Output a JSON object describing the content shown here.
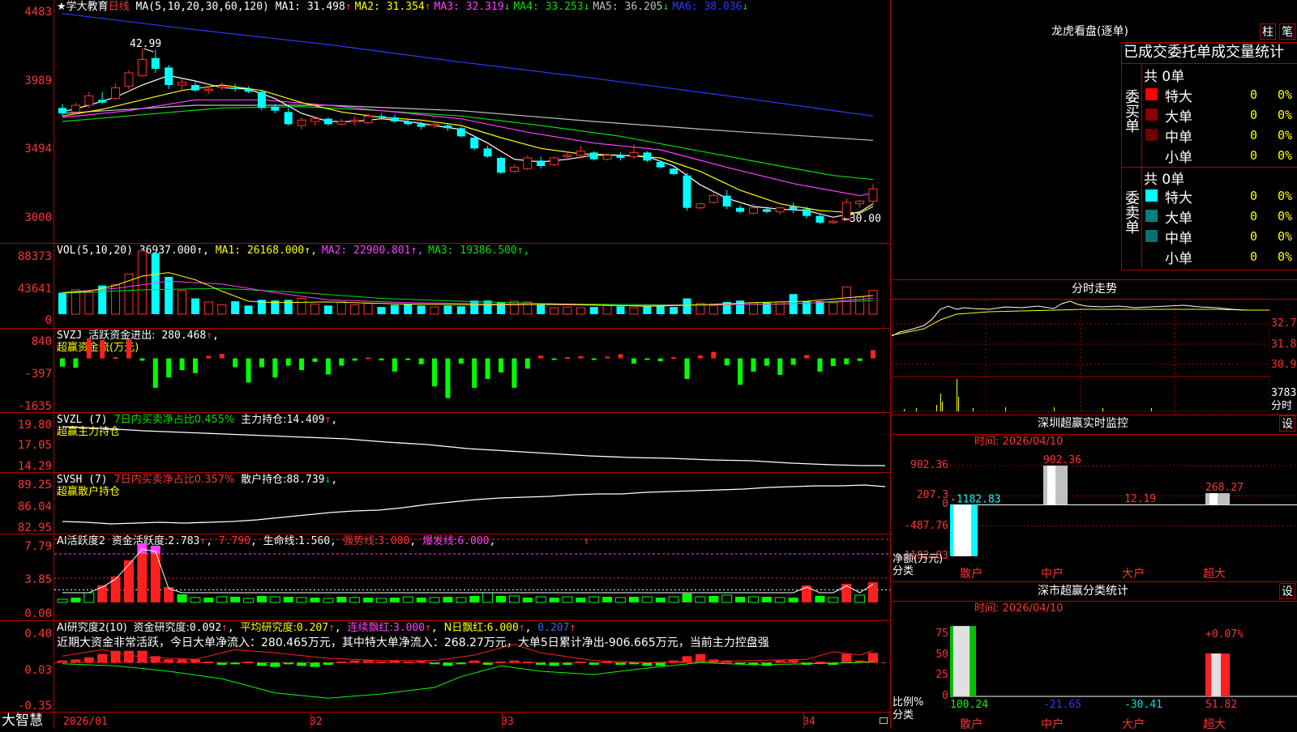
{
  "kline": {
    "title_star": "★学大教育",
    "period": "日线",
    "ma_label": "MA(5,10,20,30,60,120)",
    "ma": [
      {
        "name": "MA1",
        "value": "31.498",
        "arrow": "↑",
        "color": "#ffffff"
      },
      {
        "name": "MA2",
        "value": "31.354",
        "arrow": "↑",
        "color": "#ffff00"
      },
      {
        "name": "MA3",
        "value": "32.319",
        "arrow": "↓",
        "color": "#ff40ff"
      },
      {
        "name": "MA4",
        "value": "33.253",
        "arrow": "↓",
        "color": "#00e000"
      },
      {
        "name": "MA5",
        "value": "36.205",
        "arrow": "↓",
        "color": "#c0c0c0"
      },
      {
        "name": "MA6",
        "value": "38.036",
        "arrow": "↓",
        "color": "#2a3cff"
      }
    ],
    "y_labels": [
      "4483",
      "3989",
      "3494",
      "3000"
    ],
    "high_label": "42.99",
    "low_label": "←30.00",
    "candles": [
      [
        38.6,
        38.9,
        38.0,
        38.2
      ],
      [
        38.3,
        39.0,
        38.1,
        38.8
      ],
      [
        38.8,
        39.8,
        38.6,
        39.5
      ],
      [
        39.2,
        39.8,
        38.9,
        39.0
      ],
      [
        39.3,
        40.4,
        39.2,
        40.1
      ],
      [
        40.2,
        41.4,
        40.0,
        41.2
      ],
      [
        41.0,
        43.0,
        40.9,
        42.2
      ],
      [
        42.3,
        42.9,
        41.2,
        41.5
      ],
      [
        41.6,
        41.8,
        40.0,
        40.3
      ],
      [
        40.3,
        40.8,
        39.9,
        40.5
      ],
      [
        40.3,
        40.6,
        39.8,
        39.9
      ],
      [
        39.9,
        40.2,
        39.6,
        40.0
      ],
      [
        40.1,
        40.5,
        39.9,
        40.2
      ],
      [
        40.1,
        40.4,
        39.8,
        40.0
      ],
      [
        40.0,
        40.2,
        39.7,
        39.8
      ],
      [
        39.8,
        39.9,
        38.4,
        38.6
      ],
      [
        38.7,
        38.9,
        38.2,
        38.4
      ],
      [
        38.3,
        38.6,
        37.3,
        37.4
      ],
      [
        37.3,
        37.9,
        37.0,
        37.7
      ],
      [
        37.6,
        37.9,
        37.3,
        37.8
      ],
      [
        37.8,
        37.9,
        37.3,
        37.4
      ],
      [
        37.4,
        37.8,
        37.3,
        37.6
      ],
      [
        37.6,
        38.0,
        37.3,
        37.7
      ],
      [
        37.5,
        38.2,
        37.4,
        38.0
      ],
      [
        38.0,
        38.2,
        37.8,
        37.9
      ],
      [
        37.9,
        38.1,
        37.5,
        37.6
      ],
      [
        37.6,
        37.8,
        37.3,
        37.4
      ],
      [
        37.4,
        37.6,
        37.0,
        37.2
      ],
      [
        37.3,
        37.5,
        37.1,
        37.4
      ],
      [
        37.3,
        37.4,
        36.9,
        37.1
      ],
      [
        37.1,
        37.2,
        36.4,
        36.5
      ],
      [
        36.4,
        36.5,
        35.5,
        35.6
      ],
      [
        35.6,
        35.8,
        34.9,
        35.0
      ],
      [
        34.9,
        35.0,
        33.7,
        33.8
      ],
      [
        33.9,
        34.4,
        33.8,
        34.2
      ],
      [
        34.1,
        35.1,
        34.0,
        34.9
      ],
      [
        34.7,
        35.0,
        34.1,
        34.3
      ],
      [
        34.4,
        35.0,
        34.3,
        34.9
      ],
      [
        35.0,
        35.4,
        34.7,
        35.1
      ],
      [
        35.1,
        35.8,
        34.8,
        35.4
      ],
      [
        35.3,
        35.4,
        34.7,
        34.8
      ],
      [
        34.8,
        35.2,
        34.7,
        35.1
      ],
      [
        35.1,
        35.3,
        34.7,
        34.9
      ],
      [
        35.0,
        35.9,
        34.8,
        35.3
      ],
      [
        35.3,
        35.4,
        34.6,
        34.7
      ],
      [
        34.6,
        34.7,
        34.1,
        34.2
      ],
      [
        34.1,
        34.2,
        33.6,
        33.7
      ],
      [
        33.6,
        33.8,
        31.0,
        31.2
      ],
      [
        31.2,
        31.6,
        31.1,
        31.5
      ],
      [
        31.6,
        32.4,
        31.5,
        32.1
      ],
      [
        32.1,
        32.5,
        31.1,
        31.3
      ],
      [
        31.2,
        31.4,
        30.8,
        30.9
      ],
      [
        30.8,
        31.5,
        30.7,
        31.2
      ],
      [
        31.1,
        31.3,
        30.8,
        30.9
      ],
      [
        30.9,
        31.3,
        30.7,
        31.2
      ],
      [
        31.3,
        31.6,
        30.8,
        31.1
      ],
      [
        31.1,
        31.3,
        30.4,
        30.6
      ],
      [
        30.6,
        30.7,
        30.0,
        30.1
      ],
      [
        30.1,
        30.3,
        30.0,
        30.2
      ],
      [
        30.3,
        31.9,
        30.2,
        31.6
      ],
      [
        31.5,
        31.8,
        31.2,
        31.7
      ],
      [
        31.7,
        33.0,
        31.5,
        32.6
      ]
    ],
    "ma_lines": {
      "ma5": [
        [
          0,
          38.3
        ],
        [
          2,
          38.8
        ],
        [
          4,
          39.4
        ],
        [
          6,
          40.3
        ],
        [
          8,
          41.0
        ],
        [
          10,
          40.6
        ],
        [
          12,
          40.1
        ],
        [
          14,
          40.0
        ],
        [
          16,
          39.3
        ],
        [
          18,
          38.2
        ],
        [
          20,
          37.6
        ],
        [
          22,
          37.6
        ],
        [
          24,
          37.8
        ],
        [
          26,
          37.6
        ],
        [
          28,
          37.3
        ],
        [
          30,
          37.0
        ],
        [
          32,
          36.0
        ],
        [
          34,
          34.8
        ],
        [
          36,
          34.6
        ],
        [
          38,
          34.8
        ],
        [
          40,
          35.1
        ],
        [
          42,
          35.1
        ],
        [
          44,
          35.0
        ],
        [
          46,
          34.3
        ],
        [
          48,
          32.9
        ],
        [
          50,
          31.9
        ],
        [
          52,
          31.3
        ],
        [
          54,
          31.1
        ],
        [
          56,
          31.0
        ],
        [
          58,
          30.5
        ],
        [
          60,
          30.9
        ],
        [
          61,
          31.5
        ]
      ],
      "ma10": [
        [
          0,
          38.0
        ],
        [
          3,
          38.5
        ],
        [
          6,
          39.2
        ],
        [
          9,
          39.9
        ],
        [
          12,
          40.3
        ],
        [
          15,
          39.9
        ],
        [
          18,
          39.0
        ],
        [
          21,
          38.3
        ],
        [
          24,
          37.9
        ],
        [
          27,
          37.7
        ],
        [
          30,
          37.3
        ],
        [
          33,
          36.4
        ],
        [
          36,
          35.6
        ],
        [
          39,
          35.2
        ],
        [
          42,
          35.1
        ],
        [
          45,
          34.9
        ],
        [
          48,
          33.9
        ],
        [
          51,
          32.5
        ],
        [
          54,
          31.5
        ],
        [
          57,
          31.0
        ],
        [
          60,
          30.8
        ],
        [
          61,
          31.3
        ]
      ],
      "ma20": [
        [
          0,
          37.9
        ],
        [
          5,
          38.4
        ],
        [
          10,
          39.2
        ],
        [
          15,
          39.2
        ],
        [
          20,
          38.8
        ],
        [
          25,
          38.3
        ],
        [
          30,
          37.8
        ],
        [
          35,
          36.8
        ],
        [
          40,
          36.0
        ],
        [
          45,
          35.5
        ],
        [
          50,
          34.2
        ],
        [
          55,
          33.0
        ],
        [
          60,
          32.1
        ],
        [
          61,
          32.3
        ]
      ],
      "ma30": [
        [
          0,
          37.6
        ],
        [
          6,
          38.1
        ],
        [
          12,
          38.6
        ],
        [
          18,
          38.7
        ],
        [
          24,
          38.4
        ],
        [
          30,
          38.0
        ],
        [
          36,
          37.3
        ],
        [
          42,
          36.5
        ],
        [
          48,
          35.4
        ],
        [
          54,
          34.3
        ],
        [
          58,
          33.6
        ],
        [
          61,
          33.3
        ]
      ],
      "ma60": [
        [
          0,
          38.2
        ],
        [
          10,
          38.8
        ],
        [
          20,
          38.8
        ],
        [
          30,
          38.4
        ],
        [
          40,
          37.6
        ],
        [
          50,
          36.9
        ],
        [
          61,
          36.2
        ]
      ],
      "ma120": [
        [
          0,
          45.6
        ],
        [
          10,
          44.4
        ],
        [
          20,
          43.3
        ],
        [
          30,
          42.0
        ],
        [
          40,
          40.8
        ],
        [
          50,
          39.5
        ],
        [
          61,
          38.0
        ]
      ]
    }
  },
  "vol": {
    "label": "VOL(5,10,20)",
    "value": "36937.000↑",
    "ma": [
      {
        "name": "MA1",
        "value": "26168.000↑",
        "color": "#ffff00"
      },
      {
        "name": "MA2",
        "value": "22900.801↑",
        "color": "#ff40ff"
      },
      {
        "name": "MA3",
        "value": "19386.500↑",
        "color": "#00e000"
      }
    ],
    "y_labels": [
      "88373",
      "43641",
      "0"
    ],
    "bars": [
      30,
      34,
      30,
      40,
      41,
      56,
      88,
      85,
      52,
      33,
      22,
      17,
      13,
      18,
      12,
      20,
      19,
      20,
      22,
      14,
      12,
      17,
      13,
      15,
      10,
      13,
      14,
      12,
      10,
      12,
      11,
      19,
      19,
      17,
      18,
      17,
      13,
      9,
      10,
      9,
      10,
      12,
      11,
      9,
      11,
      12,
      10,
      22,
      15,
      12,
      17,
      19,
      16,
      16,
      17,
      28,
      18,
      18,
      16,
      38,
      24,
      33
    ]
  },
  "svzj": {
    "label": "SVZJ",
    "desc": "活跃资金进出:",
    "value": "280.468",
    "arrow": "↑",
    "sub": "超赢资金流(万元)",
    "y_labels": [
      "840",
      "-397",
      "-1635"
    ],
    "bars": [
      -280,
      -320,
      680,
      620,
      40,
      640,
      -80,
      -1000,
      -650,
      -400,
      -500,
      80,
      150,
      -300,
      -820,
      -300,
      -650,
      -250,
      -400,
      -120,
      -550,
      -250,
      -80,
      30,
      -70,
      -450,
      -60,
      -200,
      -950,
      -1350,
      -180,
      -1000,
      -700,
      -480,
      -1000,
      -350,
      90,
      -10,
      40,
      70,
      -40,
      60,
      140,
      -180,
      -40,
      -100,
      40,
      -700,
      100,
      220,
      -240,
      -900,
      -450,
      -250,
      -560,
      -220,
      110,
      -450,
      -260,
      -200,
      -90,
      280
    ]
  },
  "svzl": {
    "label": "SVZL (7)",
    "desc": "7日内买卖净占比0.455%",
    "hold_label": "主力持仓:",
    "hold_value": "14.409",
    "arrow": "↑",
    "sub": "超赢主力持仓",
    "y_labels": [
      "19.80",
      "17.05",
      "14.29"
    ]
  },
  "svsh": {
    "label": "SVSH (7)",
    "desc": "7日内买卖净占比0.357%",
    "hold_label": "散户持仓:",
    "hold_value": "88.739",
    "arrow": "↓",
    "sub": "超赢散户持仓",
    "y_labels": [
      "89.25",
      "86.04",
      "82.95"
    ]
  },
  "ai_active": {
    "label": "AI活跃度2",
    "act_label": "资金活跃度:",
    "act_value": "2.783",
    "act_arrow": "↑",
    "v2": "7.790",
    "life_label": "生命线:",
    "life_value": "1.560",
    "strong_label": "强势线:",
    "strong_value": "3.000",
    "burst_label": "爆发线:",
    "burst_value": "6.000",
    "tail_arrow": "↑",
    "y_labels": [
      "7.79",
      "3.85",
      "0.00"
    ],
    "bars": [
      0.4,
      0.6,
      1.2,
      2.1,
      3.2,
      5.2,
      7.3,
      7.0,
      1.9,
      1.0,
      0.6,
      0.6,
      0.7,
      0.7,
      0.5,
      0.8,
      0.7,
      0.7,
      0.6,
      0.6,
      0.5,
      0.7,
      0.6,
      0.6,
      0.5,
      0.6,
      0.7,
      0.6,
      0.6,
      0.7,
      0.6,
      0.8,
      1.2,
      0.8,
      0.8,
      0.6,
      0.7,
      0.6,
      0.7,
      0.6,
      0.7,
      0.7,
      0.6,
      0.7,
      0.7,
      0.6,
      0.7,
      1.1,
      0.7,
      0.8,
      0.9,
      0.7,
      0.7,
      0.7,
      0.6,
      0.6,
      2.1,
      0.8,
      0.6,
      2.3,
      0.9,
      2.5
    ]
  },
  "ai_research": {
    "label": "AI研究度2(10)",
    "fund_label": "资金研究度:",
    "fund_value": "0.092",
    "avg_label": "平均研究度:",
    "avg_value": "0.207",
    "lh_label": "连续飘红:",
    "lh_value": "3.000",
    "nh_label": "N日飘红:",
    "nh_value": "6.000",
    "last_value": "0.207",
    "summary": "近期大资金非常活跃，今日大单净流入：280.465万元，其中特大单净流入：268.27万元，大单5日累计净出-906.665万元，当前主力控盘强",
    "y_labels": [
      "0.40",
      "0.03",
      "-0.35"
    ],
    "bars": [
      0.02,
      0.03,
      0.05,
      0.08,
      0.11,
      0.11,
      0.11,
      0.06,
      0.03,
      0.03,
      0.03,
      0.01,
      -0.02,
      -0.01,
      0.01,
      -0.03,
      -0.04,
      -0.01,
      -0.03,
      -0.04,
      -0.02,
      0.01,
      0.02,
      0.02,
      0.01,
      0.02,
      0.01,
      0.02,
      -0.01,
      -0.03,
      -0.01,
      0.02,
      -0.02,
      0.01,
      0.02,
      0.01,
      -0.02,
      -0.03,
      -0.02,
      0.01,
      -0.02,
      0.01,
      -0.02,
      -0.01,
      -0.03,
      -0.03,
      0.02,
      0.06,
      0.08,
      0.03,
      0.02,
      -0.01,
      -0.02,
      -0.03,
      0.02,
      0.03,
      -0.02,
      0.01,
      -0.02,
      0.08,
      0.02,
      0.09
    ]
  },
  "x_axis": {
    "labels": [
      "2026/01",
      "02",
      "03",
      "04"
    ]
  },
  "brand": "大智慧",
  "right": {
    "lhb_title": "龙虎看盘(逐单)",
    "btn_zhu": "柱",
    "btn_bi": "笔",
    "table_title": "已成交委托单成交量统计",
    "buy_side": "委买单",
    "sell_side": "委卖单",
    "buy_total": "共 0单",
    "sell_total": "共 0单",
    "buy_rows": [
      {
        "label": "特大",
        "count": "0",
        "pct": "0%",
        "color": "#ff0000"
      },
      {
        "label": "大单",
        "count": "0",
        "pct": "0%",
        "color": "#8b0000"
      },
      {
        "label": "中单",
        "count": "0",
        "pct": "0%",
        "color": "#700000"
      },
      {
        "label": "小单",
        "count": "0",
        "pct": "0%",
        "color": ""
      }
    ],
    "sell_rows": [
      {
        "label": "特大",
        "count": "0",
        "pct": "0%",
        "color": "#00ffff"
      },
      {
        "label": "大单",
        "count": "0",
        "pct": "0%",
        "color": "#008080"
      },
      {
        "label": "中单",
        "count": "0",
        "pct": "0%",
        "color": "#007070"
      },
      {
        "label": "小单",
        "count": "0",
        "pct": "0%",
        "color": ""
      }
    ],
    "intraday_title": "分时走势",
    "intraday_labels": [
      "32.75",
      "31.84",
      "30.93",
      "3783",
      "分时"
    ],
    "sz_monitor_title": "深圳超赢实时监控",
    "sz_monitor_btn": "设",
    "sz_monitor_time": "时间: 2026/04/10",
    "monitor_y": [
      "902.36",
      "207.3",
      "0",
      "-487.76",
      "-1182.83"
    ],
    "monitor_unit": "净额(万元)",
    "monitor_axis": "分类",
    "monitor_values": [
      "-1182.83",
      "902.36",
      "12.19",
      "268.27"
    ],
    "categories": [
      "散户",
      "中户",
      "大户",
      "超大"
    ],
    "sz_class_title": "深市超赢分类统计",
    "sz_class_btn": "设",
    "sz_class_time": "时间: 2026/04/10",
    "class_y": [
      "75",
      "50",
      "25",
      "0"
    ],
    "class_unit": "比例%",
    "class_axis": "分类",
    "class_pct": "+0.07%",
    "class_values": [
      "100.24",
      "-21.65",
      "-30.41",
      "51.82"
    ]
  }
}
